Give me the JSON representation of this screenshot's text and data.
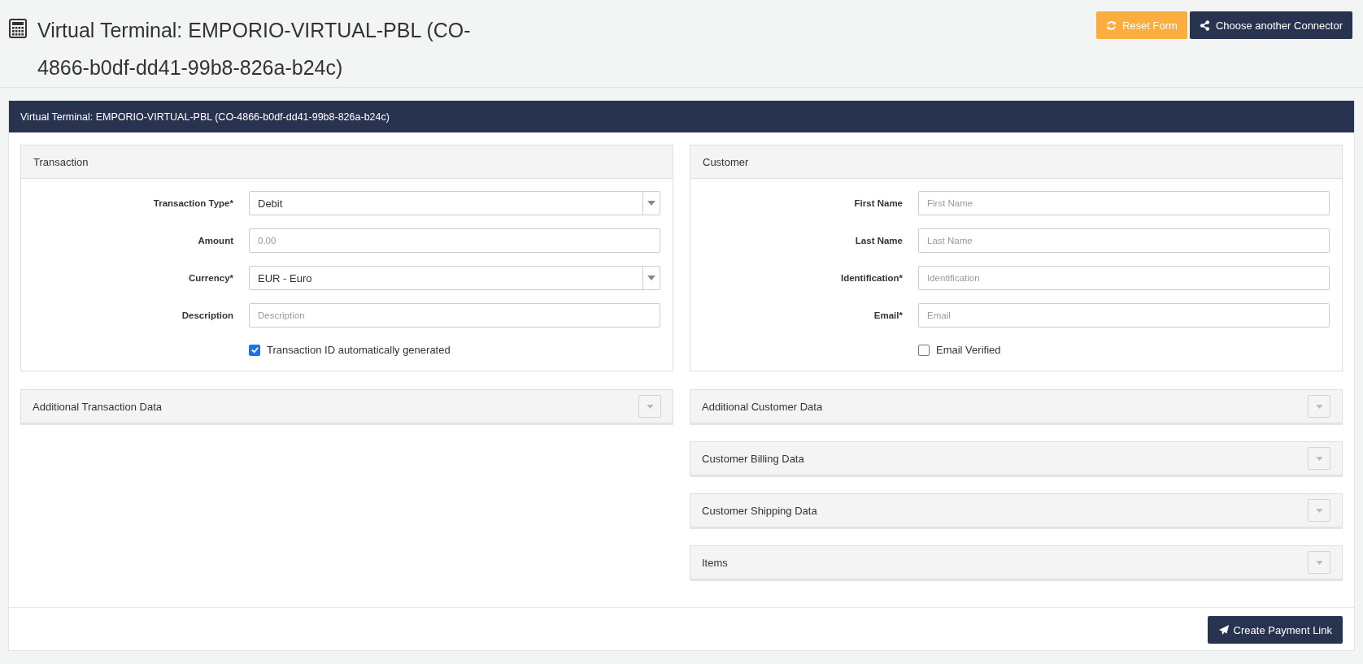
{
  "page": {
    "title": "Virtual Terminal: EMPORIO-VIRTUAL-PBL (CO-4866-b0df-dd41-99b8-826a-b24c)"
  },
  "header_buttons": [
    {
      "kind": "reset",
      "label": "Reset Form"
    },
    {
      "kind": "connector",
      "label": "Choose another Connector"
    }
  ],
  "panel": {
    "title": "Virtual Terminal: EMPORIO-VIRTUAL-PBL (CO-4866-b0df-dd41-99b8-826a-b24c)"
  },
  "transaction": {
    "title": "Transaction",
    "fields": [
      {
        "kind": "select",
        "label": "Transaction Type*",
        "value": "Debit"
      },
      {
        "kind": "input",
        "label": "Amount",
        "placeholder": "0.00"
      },
      {
        "kind": "select",
        "label": "Currency*",
        "value": "EUR - Euro"
      },
      {
        "kind": "input",
        "label": "Description",
        "placeholder": "Description"
      }
    ],
    "checkbox": {
      "label": "Transaction ID automatically generated",
      "checked": true
    }
  },
  "customer": {
    "title": "Customer",
    "fields": [
      {
        "kind": "input",
        "label": "First Name",
        "placeholder": "First Name"
      },
      {
        "kind": "input",
        "label": "Last Name",
        "placeholder": "Last Name"
      },
      {
        "kind": "input",
        "label": "Identification*",
        "placeholder": "Identification"
      },
      {
        "kind": "input",
        "label": "Email*",
        "placeholder": "Email"
      }
    ],
    "checkbox": {
      "label": "Email Verified",
      "checked": false
    }
  },
  "left_sections": [
    "Additional Transaction Data"
  ],
  "right_sections": [
    "Additional Customer Data",
    "Customer Billing Data",
    "Customer Shipping Data",
    "Items"
  ],
  "footer_button": "Create Payment Link"
}
